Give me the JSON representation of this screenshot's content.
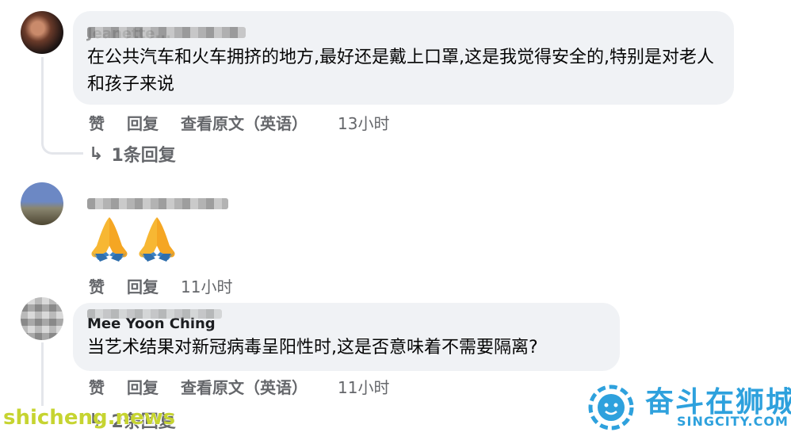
{
  "comments": [
    {
      "name": "Jeanette...",
      "text": "在公共汽车和火车拥挤的地方,最好还是戴上口罩,这是我觉得安全的,特别是对老人和孩子来说",
      "actions": [
        "赞",
        "回复",
        "查看原文（英语）"
      ],
      "time": "13小时",
      "replies_label": "1条回复"
    },
    {
      "name": "",
      "emoji": "folded-hands",
      "actions": [
        "赞",
        "回复"
      ],
      "time": "11小时"
    },
    {
      "name": "Mee Yoon Ching",
      "text": "当艺术结果对新冠病毒呈阳性时,这是否意味着不需要隔离?",
      "actions": [
        "赞",
        "回复",
        "查看原文（英语）"
      ],
      "time": "11小时",
      "replies_label": "2条回复"
    }
  ],
  "watermarks": {
    "left": "shicheng.news",
    "right_cn": "奋斗在狮城",
    "right_en": "SINGCITY.COM"
  },
  "colors": {
    "bubble": "#f0f2f5",
    "secondary_text": "#65676b",
    "brand_blue": "#2ea1dd",
    "watermark_green": "#c6d431"
  },
  "icons": {
    "reply_arrow": "reply-arrow-icon",
    "emoji": "folded-hands-icon",
    "logo": "lion-logo-icon"
  }
}
